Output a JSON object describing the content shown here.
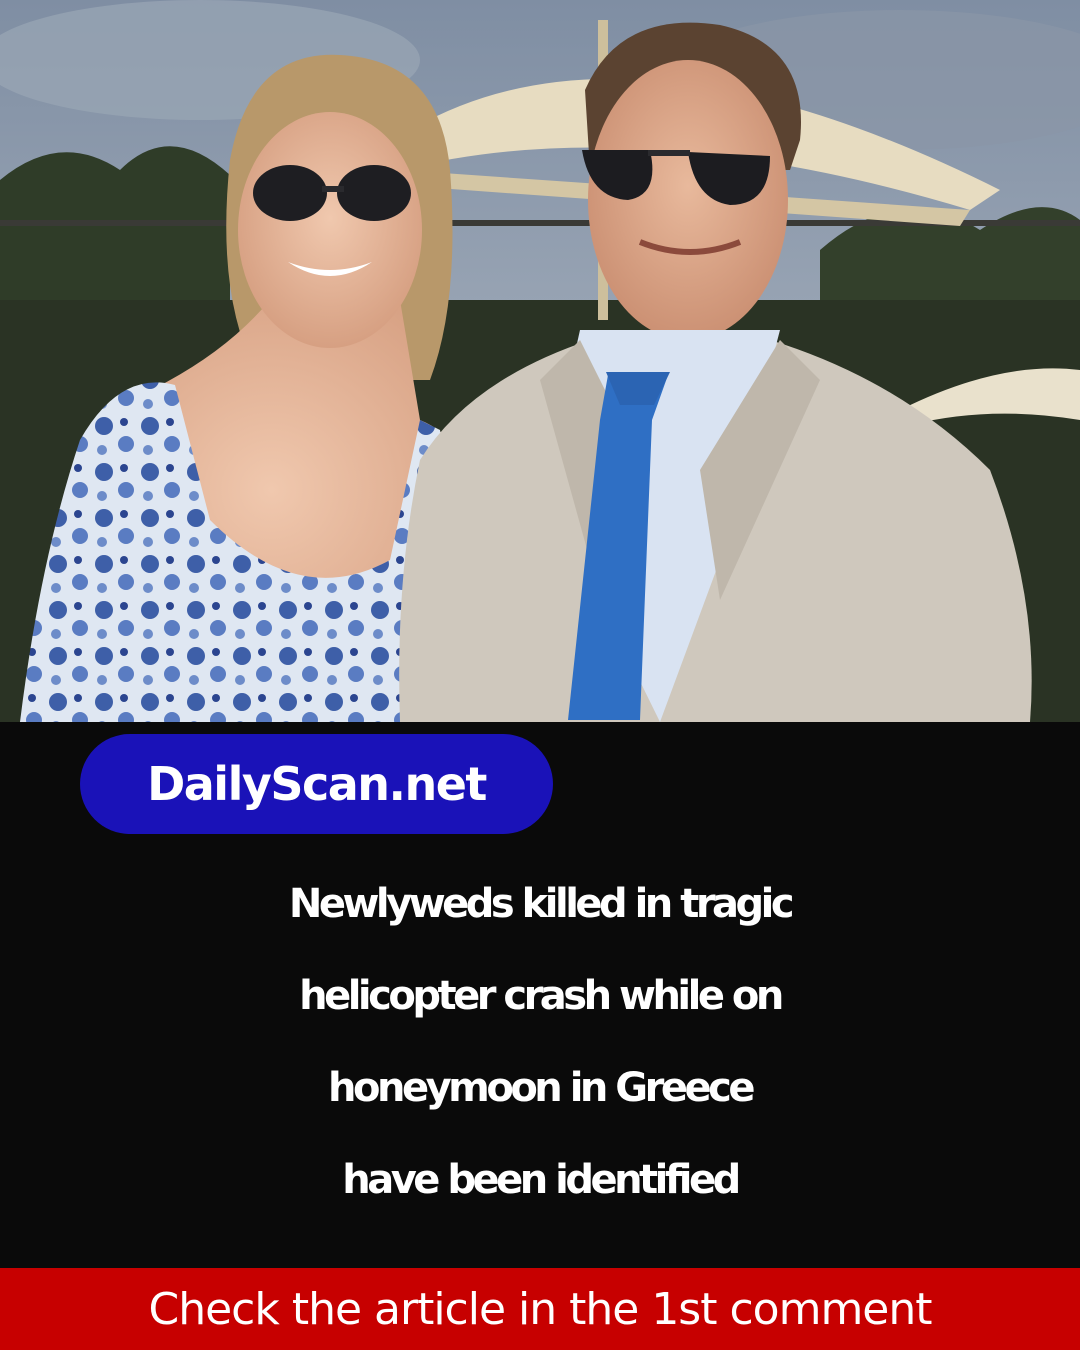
{
  "brand": {
    "site_name": "DailyScan.net",
    "pill_color": "#1a12b8"
  },
  "headline": {
    "lines": [
      "Newlyweds killed in tragic",
      "helicopter crash while on",
      "honeymoon in Greece",
      "have been identified"
    ]
  },
  "cta": {
    "text": "Check the article in the 1st comment",
    "bar_color": "#c70000"
  },
  "photo": {
    "subject": "photo-of-couple"
  }
}
